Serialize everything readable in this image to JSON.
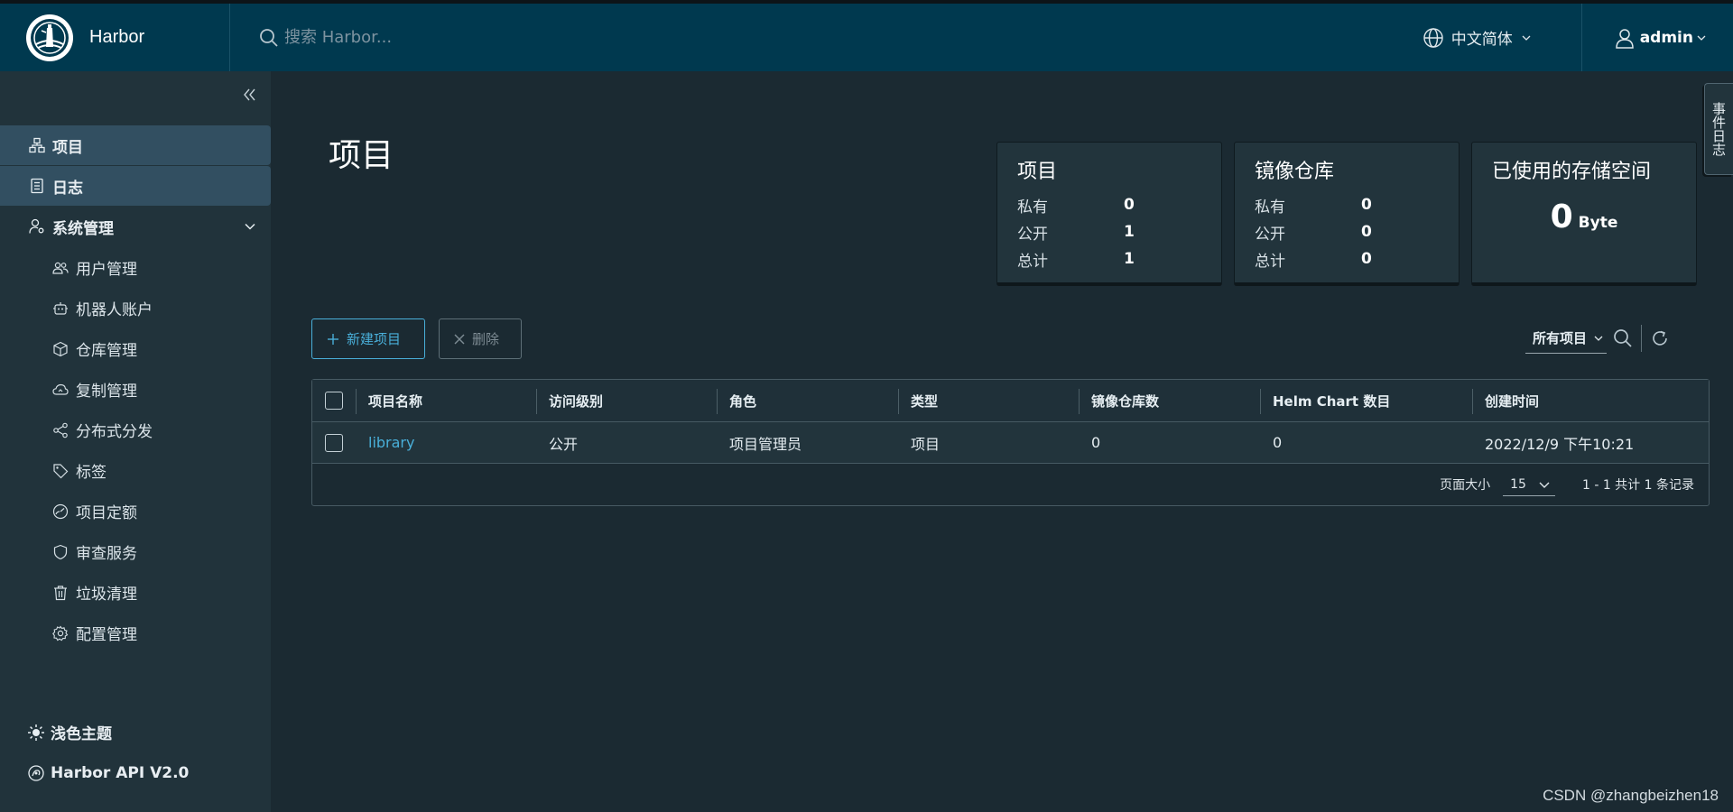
{
  "header": {
    "app_name": "Harbor",
    "search_placeholder": "搜索 Harbor...",
    "language": "中文简体",
    "user": "admin"
  },
  "sidebar": {
    "items": [
      {
        "label": "项目",
        "icon": "projects-icon",
        "active": true
      },
      {
        "label": "日志",
        "icon": "logs-icon",
        "active": true
      },
      {
        "label": "系统管理",
        "icon": "admin-icon",
        "expanded": true
      }
    ],
    "sub_items": [
      {
        "label": "用户管理",
        "icon": "users-icon"
      },
      {
        "label": "机器人账户",
        "icon": "robot-icon"
      },
      {
        "label": "仓库管理",
        "icon": "registry-icon"
      },
      {
        "label": "复制管理",
        "icon": "cloud-icon"
      },
      {
        "label": "分布式分发",
        "icon": "share-icon"
      },
      {
        "label": "标签",
        "icon": "tag-icon"
      },
      {
        "label": "项目定额",
        "icon": "dashboard-icon"
      },
      {
        "label": "审查服务",
        "icon": "shield-icon"
      },
      {
        "label": "垃圾清理",
        "icon": "trash-icon"
      },
      {
        "label": "配置管理",
        "icon": "gear-icon"
      }
    ],
    "footer": {
      "theme": "浅色主题",
      "api": "Harbor API V2.0"
    }
  },
  "main": {
    "title": "项目",
    "cards": {
      "projects": {
        "title": "项目",
        "rows": [
          {
            "k": "私有",
            "v": "0"
          },
          {
            "k": "公开",
            "v": "1"
          },
          {
            "k": "总计",
            "v": "1"
          }
        ]
      },
      "repos": {
        "title": "镜像仓库",
        "rows": [
          {
            "k": "私有",
            "v": "0"
          },
          {
            "k": "公开",
            "v": "0"
          },
          {
            "k": "总计",
            "v": "0"
          }
        ]
      },
      "storage": {
        "title": "已使用的存储空间",
        "value": "0",
        "unit": "Byte"
      }
    },
    "buttons": {
      "new_project": "新建项目",
      "delete": "删除"
    },
    "filter": {
      "selected": "所有项目"
    },
    "table": {
      "columns": [
        "项目名称",
        "访问级别",
        "角色",
        "类型",
        "镜像仓库数",
        "Helm Chart 数目",
        "创建时间"
      ],
      "rows": [
        {
          "name": "library",
          "access": "公开",
          "role": "项目管理员",
          "type": "项目",
          "repo_count": "0",
          "helm_count": "0",
          "created": "2022/12/9 下午10:21"
        }
      ],
      "footer": {
        "page_size_label": "页面大小",
        "page_size": "15",
        "summary": "1 - 1 共计 1 条记录"
      }
    },
    "side_tab": "事件日志"
  },
  "watermark": "CSDN @zhangbeizhen18",
  "colors": {
    "header_bg": "#00394f",
    "sidebar_bg": "#21333b",
    "main_bg": "#1b2a32",
    "accent": "#49afd9"
  }
}
